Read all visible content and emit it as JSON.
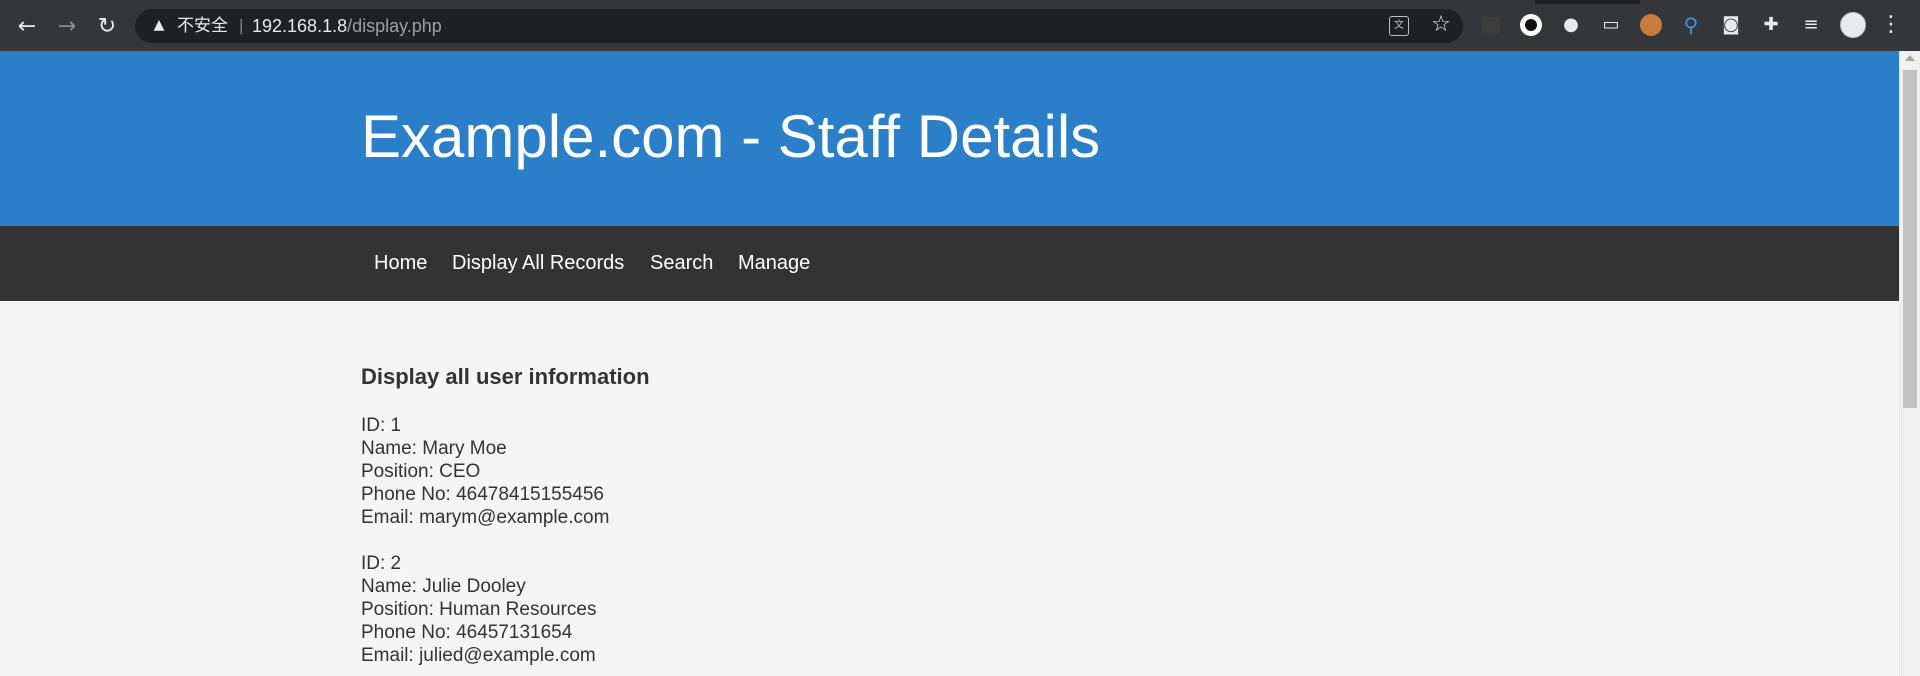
{
  "browser": {
    "security_label": "不安全",
    "separator": "|",
    "url_host": "192.168.1.8",
    "url_path": "/display.php",
    "icons": [
      "back-icon",
      "forward-icon",
      "reload-icon",
      "warning-icon",
      "translate-icon",
      "star-icon",
      "puzzle-icon",
      "reading-list-icon",
      "profile-avatar",
      "menu-icon"
    ]
  },
  "header": {
    "title": "Example.com - Staff Details",
    "background": "#2b7fc8"
  },
  "nav": {
    "background": "#333333",
    "items": [
      {
        "label": "Home"
      },
      {
        "label": "Display All Records"
      },
      {
        "label": "Search"
      },
      {
        "label": "Manage"
      }
    ]
  },
  "content": {
    "heading": "Display all user information",
    "records": [
      {
        "id": "ID: 1",
        "name": "Name: Mary Moe",
        "position": "Position: CEO",
        "phone": "Phone No: 46478415155456",
        "email": "Email: marym@example.com"
      },
      {
        "id": "ID: 2",
        "name": "Name: Julie Dooley",
        "position": "Position: Human Resources",
        "phone": "Phone No: 46457131654",
        "email": "Email: julied@example.com"
      }
    ]
  }
}
